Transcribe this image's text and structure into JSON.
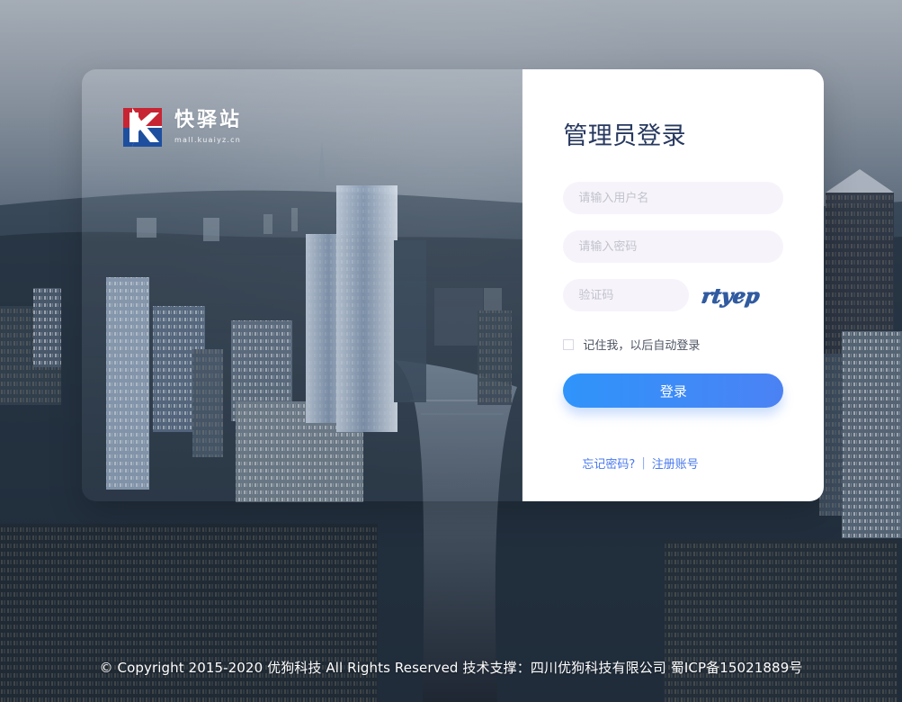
{
  "brand": {
    "name": "快驿站",
    "domain": "mall.kuaiyz.cn",
    "logo_letter": "K",
    "colors": {
      "red": "#c72534",
      "blue": "#1e4f9f",
      "white": "#ffffff"
    }
  },
  "login_form": {
    "title": "管理员登录",
    "username_placeholder": "请输入用户名",
    "password_placeholder": "请输入密码",
    "captcha_placeholder": "验证码",
    "captcha_code": "rtyep",
    "remember_label": "记住我，以后自动登录",
    "submit_label": "登录",
    "forgot_password_label": "忘记密码?",
    "register_label": "注册账号",
    "divider": "|"
  },
  "footer": {
    "copyright": "© Copyright 2015-2020 优狗科技 All Rights Reserved 技术支撑：四川优狗科技有限公司 蜀ICP备15021889号"
  },
  "theme": {
    "accent": "#3b8cf8",
    "title_color": "#27385f",
    "input_bg": "#f7f3fb",
    "link_color": "#4a79ee"
  },
  "icons": {
    "logo": "brand-logo-icon",
    "checkbox": "checkbox-icon",
    "background": "city-skyline-background"
  }
}
